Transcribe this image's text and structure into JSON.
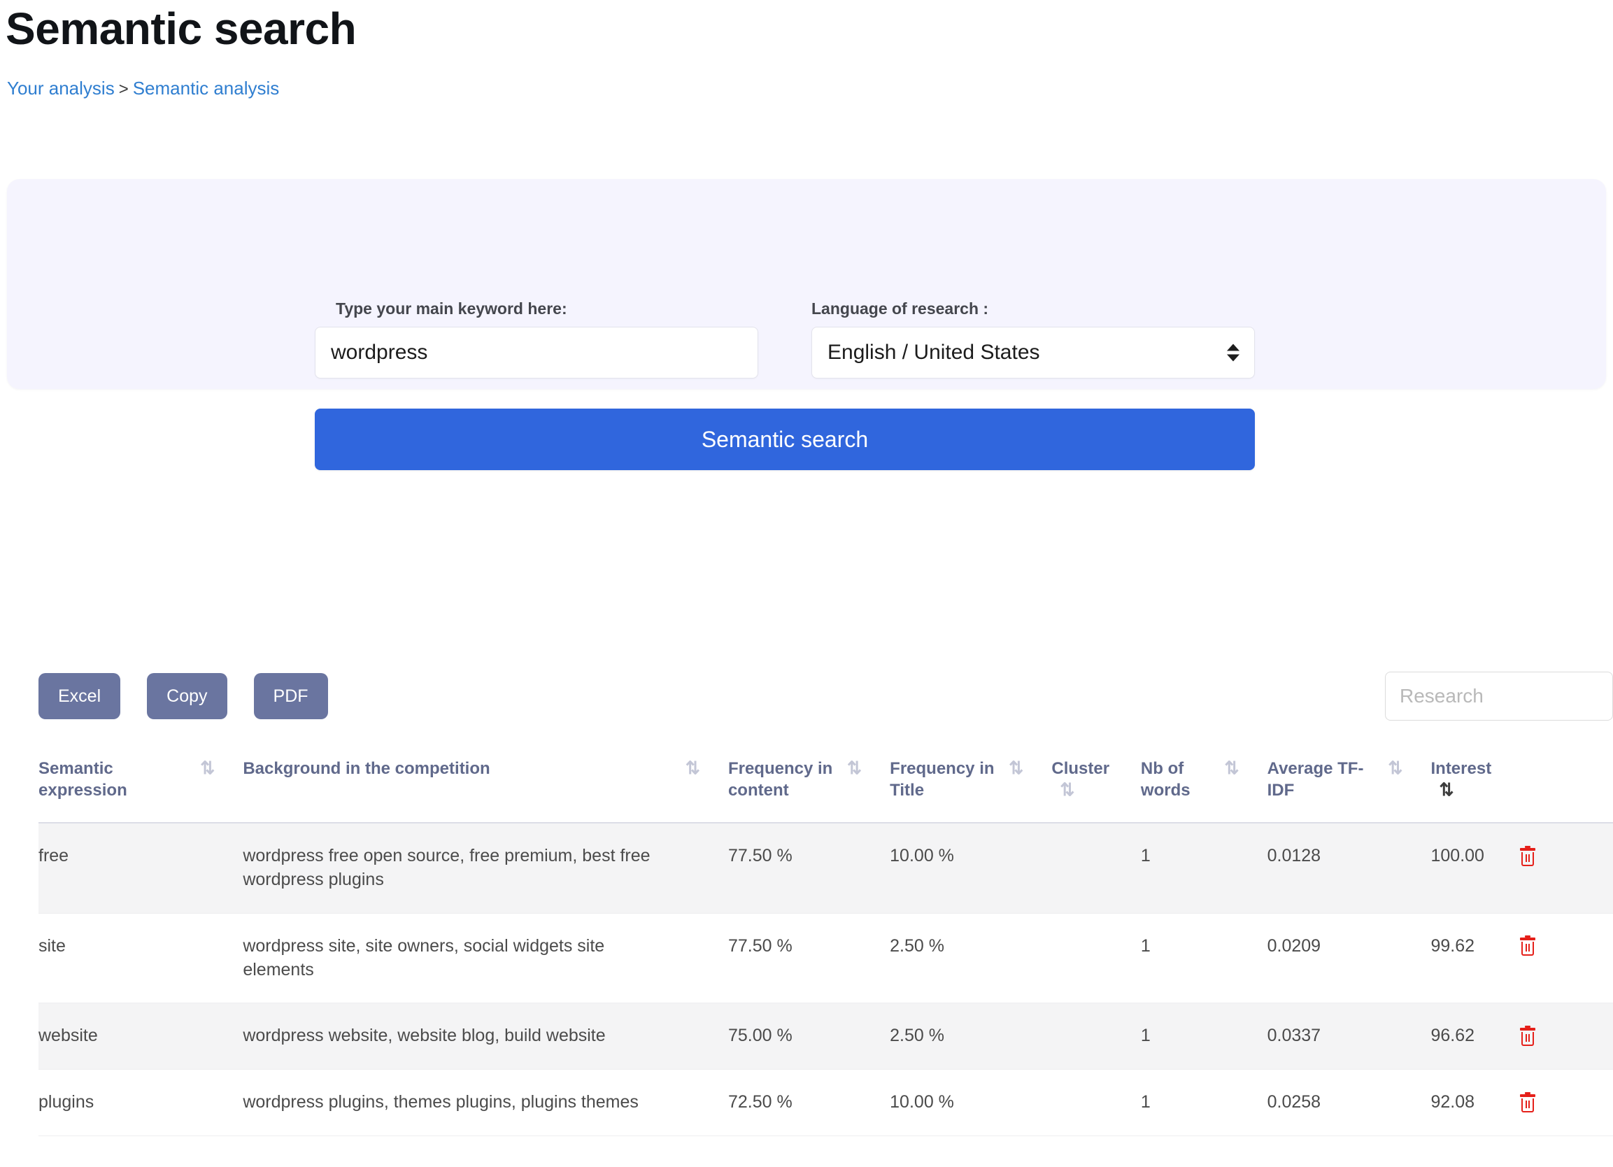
{
  "header": {
    "title": "Semantic search",
    "breadcrumb": {
      "first": "Your analysis",
      "separator": ">",
      "second": "Semantic analysis"
    }
  },
  "search_panel": {
    "keyword_label": "Type your main keyword here:",
    "keyword_value": "wordpress",
    "keyword_placeholder": "",
    "language_label": "Language of research :",
    "language_value": "English / United States",
    "submit_label": "Semantic search",
    "panel_color": "#f5f4fe",
    "submit_color": "#3066dd"
  },
  "toolbar": {
    "excel_label": "Excel",
    "copy_label": "Copy",
    "pdf_label": "PDF",
    "research_placeholder": "Research",
    "export_button_color": "#6a75a0"
  },
  "table": {
    "columns": [
      {
        "label": "Semantic expression",
        "sortable": true,
        "sort_state": "none"
      },
      {
        "label": "Background in the competition",
        "sortable": true,
        "sort_state": "none"
      },
      {
        "label": "Frequency in content",
        "sortable": true,
        "sort_state": "none"
      },
      {
        "label": "Frequency in Title",
        "sortable": true,
        "sort_state": "none"
      },
      {
        "label": "Cluster",
        "sortable": true,
        "sort_state": "none"
      },
      {
        "label": "Nb of words",
        "sortable": true,
        "sort_state": "none"
      },
      {
        "label": "Average TF-IDF",
        "sortable": true,
        "sort_state": "none"
      },
      {
        "label": "Interest",
        "sortable": true,
        "sort_state": "desc"
      }
    ],
    "sort_glyph": "⇅",
    "rows": [
      {
        "expression": "free",
        "background": "wordpress free open source, free premium, best free wordpress plugins",
        "frequency_content": "77.50 %",
        "frequency_title": "10.00 %",
        "cluster": "",
        "nb_words": "1",
        "avg_tfidf": "0.0128",
        "interest": "100.00",
        "delete_icon": "trash-icon"
      },
      {
        "expression": "site",
        "background": "wordpress site, site owners, social widgets site elements",
        "frequency_content": "77.50 %",
        "frequency_title": "2.50 %",
        "cluster": "",
        "nb_words": "1",
        "avg_tfidf": "0.0209",
        "interest": "99.62",
        "delete_icon": "trash-icon"
      },
      {
        "expression": "website",
        "background": "wordpress website, website blog, build website",
        "frequency_content": "75.00 %",
        "frequency_title": "2.50 %",
        "cluster": "",
        "nb_words": "1",
        "avg_tfidf": "0.0337",
        "interest": "96.62",
        "delete_icon": "trash-icon"
      },
      {
        "expression": "plugins",
        "background": "wordpress plugins, themes plugins, plugins themes",
        "frequency_content": "72.50 %",
        "frequency_title": "10.00 %",
        "cluster": "",
        "nb_words": "1",
        "avg_tfidf": "0.0258",
        "interest": "92.08",
        "delete_icon": "trash-icon"
      }
    ]
  }
}
